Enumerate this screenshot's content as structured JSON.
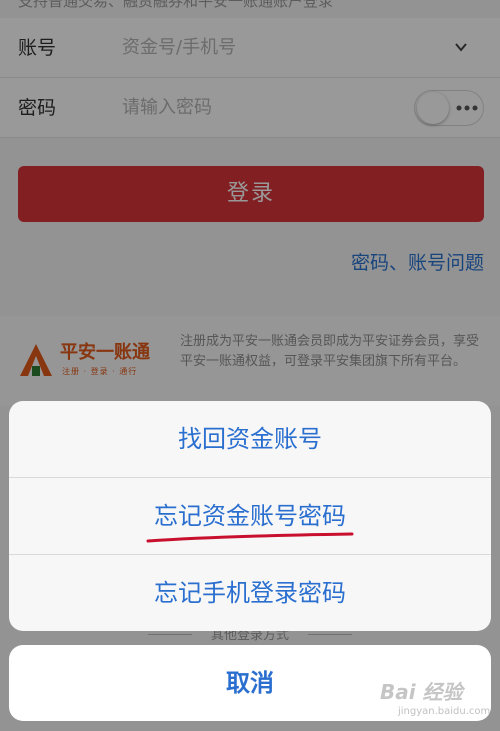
{
  "top_hint": "支持普通交易、融资融券和平安一账通账户登录",
  "form": {
    "account_label": "账号",
    "account_placeholder": "资金号/手机号",
    "password_label": "密码",
    "password_placeholder": "请输入密码"
  },
  "login_button": "登录",
  "password_issue_link": "密码、账号问题",
  "member": {
    "logo_text": "平安一账通",
    "logo_sub": "注册 · 登录 · 通行",
    "description": "注册成为平安一账通会员即成为平安证券会员，享受平安一账通权益，可登录平安集团旗下所有平台。"
  },
  "other_login": "其他登录方式",
  "action_sheet": {
    "items": [
      "找回资金账号",
      "忘记资金账号密码",
      "忘记手机登录密码"
    ],
    "cancel": "取消"
  },
  "watermark": {
    "brand": "Bai 经验",
    "url": "jingyan.baidu.com"
  },
  "colors": {
    "brand_red": "#d8343a",
    "link_blue": "#2a73d0",
    "sheet_blue": "#2a6fcf",
    "logo_orange": "#e35a1b",
    "annotation_red": "#c8102e"
  },
  "icons": [
    "chevron-down-icon",
    "password-visibility-toggle",
    "pingan-logo-icon"
  ]
}
